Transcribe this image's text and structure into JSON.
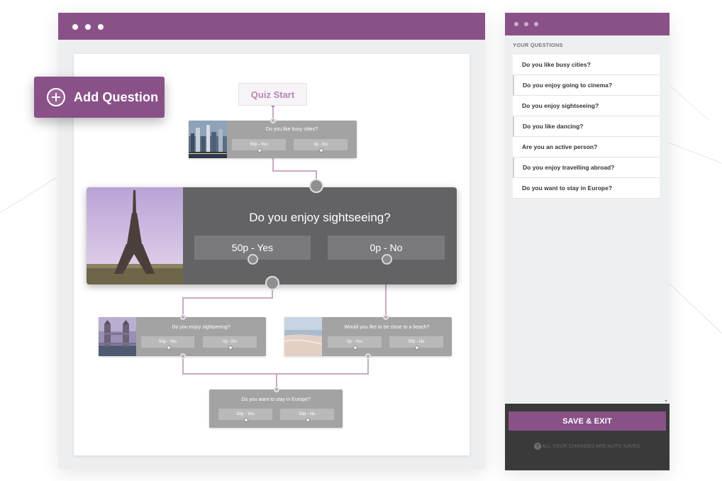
{
  "main": {
    "add_question_label": "Add Question",
    "quiz_start_label": "Quiz Start"
  },
  "nodes": {
    "busy_cities": {
      "question": "Do you like busy cities?",
      "answers": [
        "50p - Yes",
        "0p - No"
      ]
    },
    "sightseeing_main": {
      "question": "Do you enjoy sightseeing?",
      "answers": [
        "50p - Yes",
        "0p - No"
      ]
    },
    "sightseeing_small": {
      "question": "Do you enjoy sightseeing?",
      "answers": [
        "50p - Yes",
        "0p - No"
      ]
    },
    "beach": {
      "question": "Would you like to be close to a beach?",
      "answers": [
        "0p - Yes",
        "50p - No"
      ]
    },
    "europe": {
      "question": "Do you want to stay in Europe?",
      "answers": [
        "50p - Yes",
        "50p - No"
      ]
    }
  },
  "sidebar": {
    "heading": "YOUR QUESTIONS",
    "questions": [
      "Do you like busy cities?",
      "Do you enjoy going to cinema?",
      "Do you enjoy sightseeing?",
      "Do you like dancing?",
      "Are you an active person?",
      "Do you enjoy travelling abroad?",
      "Do you want to stay in Europe?"
    ],
    "save_label": "SAVE & EXIT",
    "autosave_text": "ALL YOUR CHANGES ARE AUTO SAVED"
  },
  "icons": {
    "add": "plus-circle-icon",
    "help": "question-circle-icon"
  },
  "colors": {
    "brand_purple": "#8a5189",
    "node_gray": "#a3a3a3",
    "node_dark": "#636366",
    "connector": "#c9a9c8"
  }
}
